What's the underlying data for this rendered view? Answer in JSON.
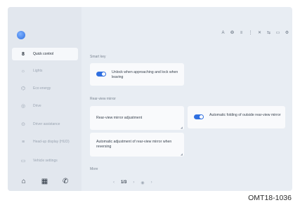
{
  "sidebar": {
    "items": [
      {
        "label": "Quick control",
        "icon": "car-icon",
        "active": true
      },
      {
        "label": "Lights",
        "icon": "light-icon"
      },
      {
        "label": "Eco energy",
        "icon": "leaf-icon"
      },
      {
        "label": "Drive",
        "icon": "steering-icon"
      },
      {
        "label": "Driver assistance",
        "icon": "assist-icon"
      },
      {
        "label": "Head-up display (HUD)",
        "icon": "hud-icon"
      },
      {
        "label": "Vehicle settings",
        "icon": "settings-icon"
      }
    ],
    "dock": [
      "⌂",
      "▦",
      "✆"
    ]
  },
  "topbar": {
    "icons": [
      "A",
      "❂",
      "≡",
      "⋮",
      "✕",
      "⇆",
      "▭",
      "⚙"
    ]
  },
  "sections": {
    "smart_key": "Smart key",
    "rear_view_mirror": "Rear-view mirror",
    "more": "More"
  },
  "cards": {
    "unlock": "Unlock when approaching and lock when leaving",
    "mirror_adjust": "Rear-view mirror adjustment",
    "mirror_reverse": "Automatic adjustment of rear-view mirror when reversing",
    "auto_fold": "Automatic folding of outside rear-view mirror"
  },
  "pager": [
    "‹",
    "1/3",
    "›",
    "◉",
    "›"
  ],
  "caption": "OMT18-1036",
  "colors": {
    "accent": "#2f6fe0",
    "screen_bg": "#e8edf3",
    "card_bg": "#f9fafc"
  }
}
